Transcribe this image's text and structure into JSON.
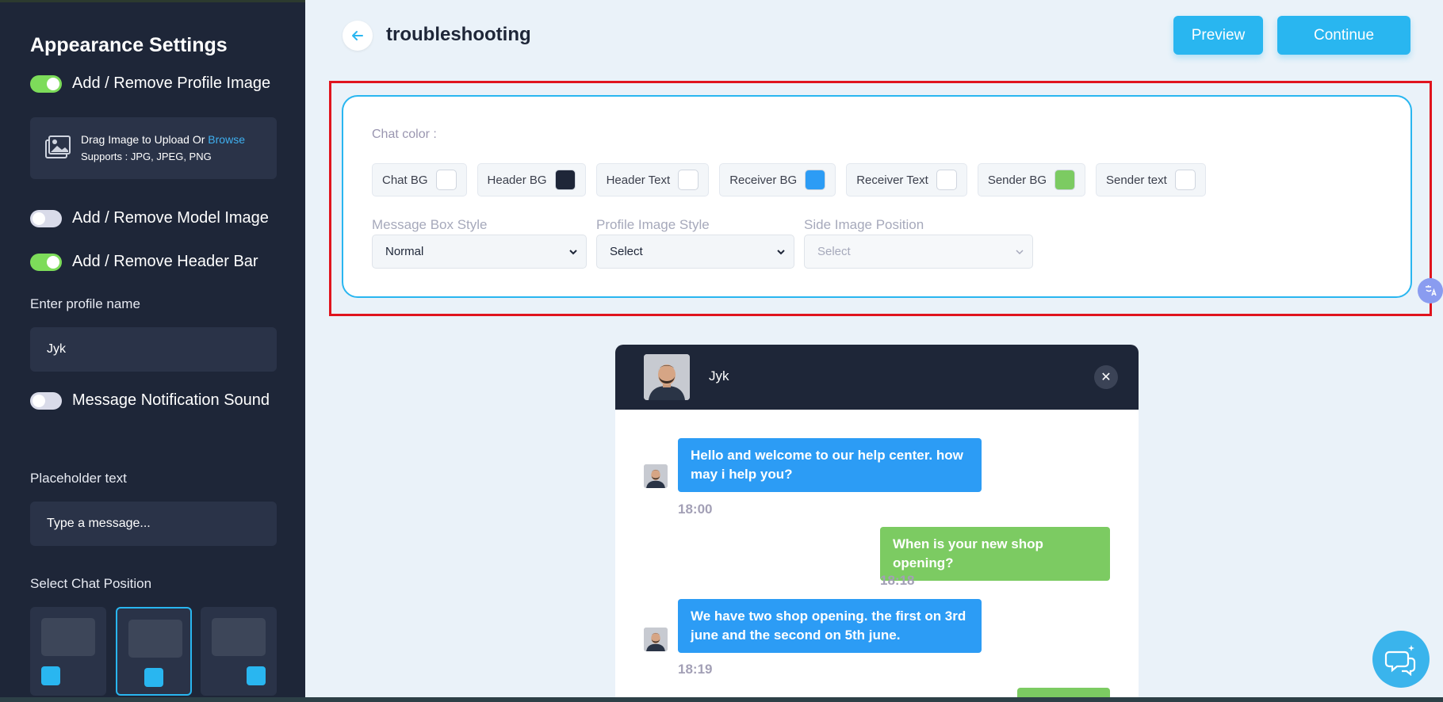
{
  "sidebar": {
    "title": "Appearance Settings",
    "toggles": {
      "profile_image": "Add / Remove Profile Image",
      "model_image": "Add / Remove Model Image",
      "header_bar": "Add / Remove Header Bar",
      "notification_sound": "Message Notification Sound"
    },
    "upload": {
      "line1": "Drag Image to Upload Or",
      "browse": "Browse",
      "line2": "Supports : JPG, JPEG, PNG"
    },
    "profile_name_label": "Enter profile name",
    "profile_name_value": "Jyk",
    "placeholder_label": "Placeholder text",
    "placeholder_value": "Type a message...",
    "chat_position_label": "Select Chat Position"
  },
  "header": {
    "title": "troubleshooting",
    "preview_label": "Preview",
    "continue_label": "Continue"
  },
  "settings": {
    "chat_color_label": "Chat color :",
    "chips": [
      {
        "label": "Chat BG",
        "color": "#ffffff"
      },
      {
        "label": "Header BG",
        "color": "#1e2638"
      },
      {
        "label": "Header Text",
        "color": "#ffffff"
      },
      {
        "label": "Receiver BG",
        "color": "#2c9cf5"
      },
      {
        "label": "Receiver Text",
        "color": "#ffffff"
      },
      {
        "label": "Sender BG",
        "color": "#7ccb62"
      },
      {
        "label": "Sender text",
        "color": "#ffffff"
      }
    ],
    "message_box_style_label": "Message Box Style",
    "message_box_style_value": "Normal",
    "profile_image_style_label": "Profile Image Style",
    "profile_image_style_value": "Select",
    "side_image_position_label": "Side Image Position",
    "side_image_position_value": "Select"
  },
  "chat": {
    "name": "Jyk",
    "messages": [
      {
        "text": "Hello and welcome to our help center. how may i help you?",
        "time": "18:00"
      },
      {
        "text": "When is your new shop opening?",
        "time": "18:18"
      },
      {
        "text": "We have two shop opening. the first on 3rd june and the second on 5th june.",
        "time": "18:19"
      }
    ]
  },
  "colors": {
    "accent": "#29b6f0",
    "sidebar_bg": "#1e2638",
    "highlight": "#e0141e"
  }
}
